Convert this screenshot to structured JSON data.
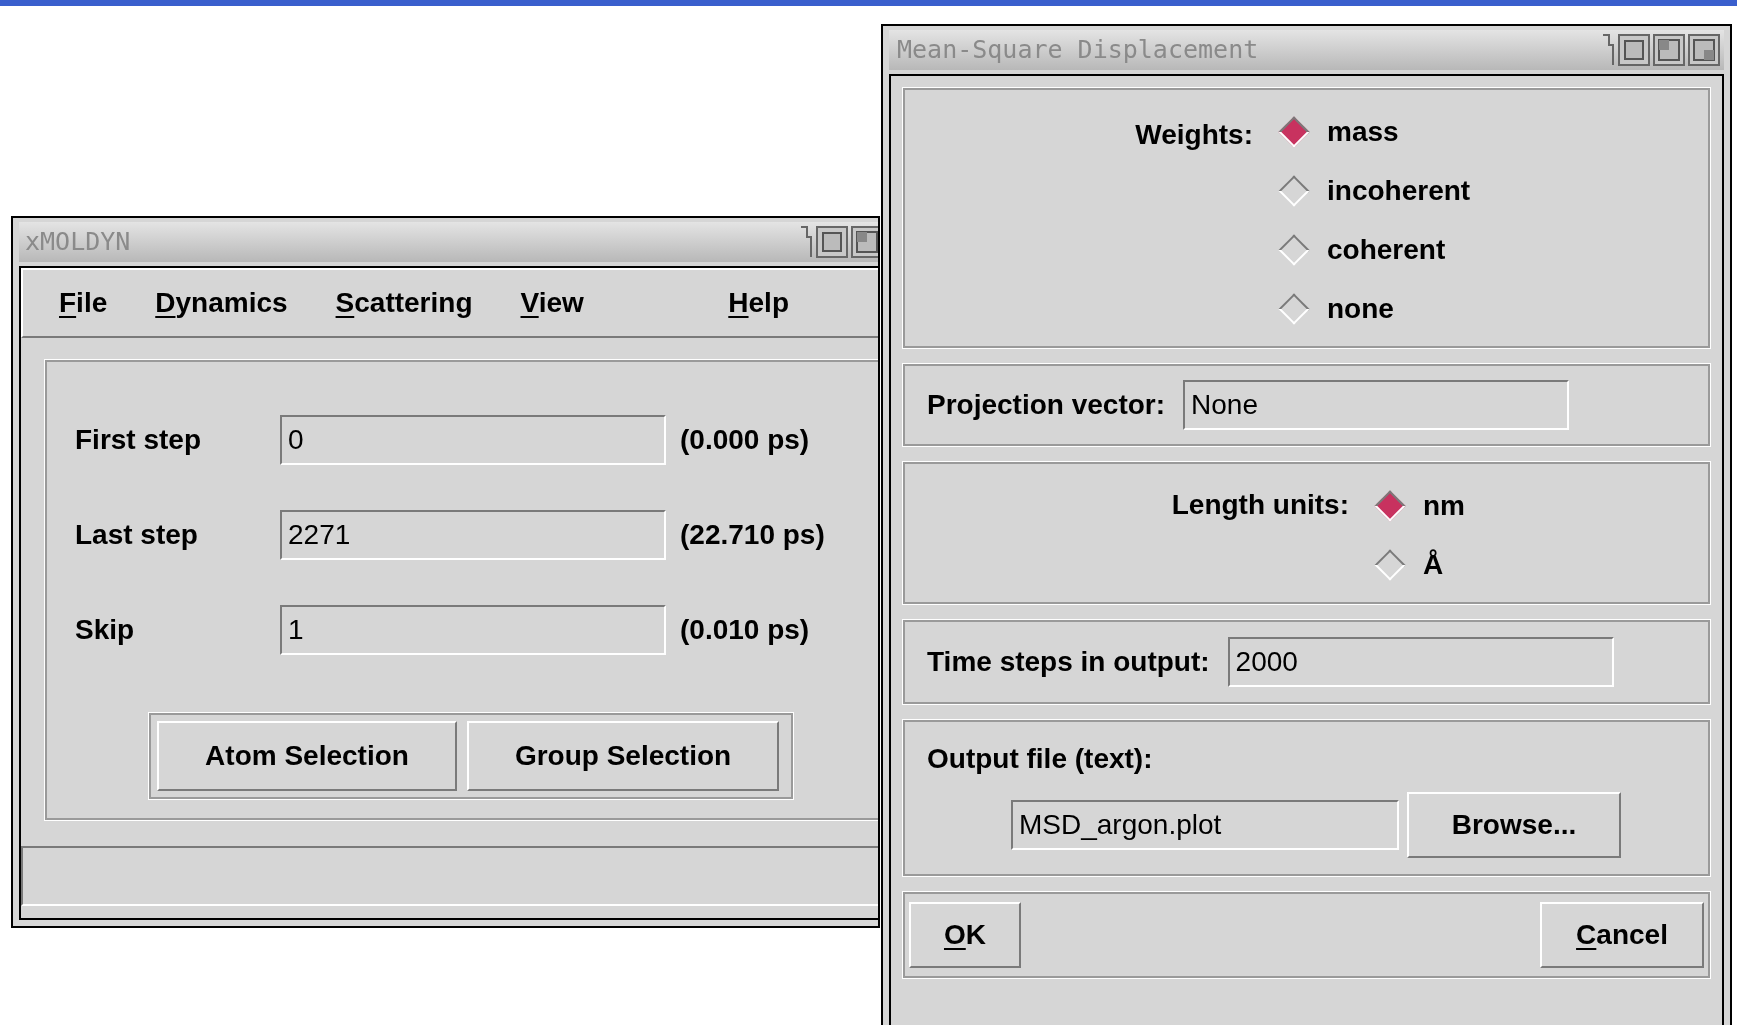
{
  "main_window": {
    "title": "xMOLDYN",
    "menu": [
      {
        "label": "File",
        "mnemonic": true
      },
      {
        "label": "Dynamics",
        "mnemonic": true
      },
      {
        "label": "Scattering",
        "mnemonic": true
      },
      {
        "label": "View",
        "mnemonic": true
      },
      {
        "label": "Help",
        "mnemonic": true
      }
    ],
    "fields": [
      {
        "label": "First step",
        "value": "0",
        "reading": "(0.000 ps)"
      },
      {
        "label": "Last step",
        "value": "2271",
        "reading": "(22.710 ps)"
      },
      {
        "label": "Skip",
        "value": "1",
        "reading": "(0.010 ps)"
      }
    ],
    "buttons": [
      "Atom Selection",
      "Group Selection"
    ]
  },
  "dialog": {
    "title": "Mean-Square Displacement",
    "weights": {
      "label": "Weights:",
      "options": [
        {
          "label": "mass",
          "selected": true
        },
        {
          "label": "incoherent",
          "selected": false
        },
        {
          "label": "coherent",
          "selected": false
        },
        {
          "label": "none",
          "selected": false
        }
      ]
    },
    "projection": {
      "label": "Projection vector:",
      "value": "None"
    },
    "length_units": {
      "label": "Length units:",
      "options": [
        {
          "label": "nm",
          "selected": true
        },
        {
          "label": "Å",
          "selected": false
        }
      ]
    },
    "time_steps": {
      "label": "Time steps in output:",
      "value": "2000"
    },
    "output_file": {
      "label": "Output file (text):",
      "value": "MSD_argon.plot",
      "browse": "Browse..."
    },
    "buttons": [
      {
        "label": "OK",
        "mnemonic": true
      },
      {
        "label": "Cancel",
        "mnemonic": true
      }
    ]
  }
}
